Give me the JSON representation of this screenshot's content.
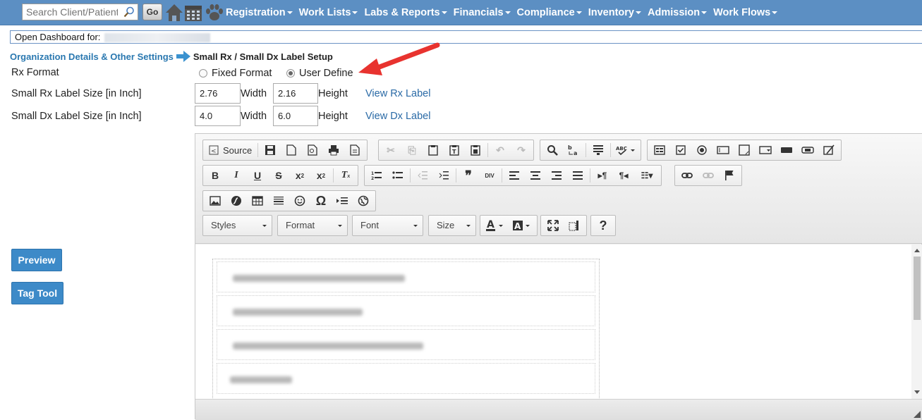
{
  "nav": {
    "search_placeholder": "Search Client/Patient",
    "go_label": "Go",
    "menu": [
      "Registration",
      "Work Lists",
      "Labs & Reports",
      "Financials",
      "Compliance",
      "Inventory",
      "Admission",
      "Work Flows"
    ],
    "icons": [
      "search-icon",
      "home-icon",
      "calendar-icon",
      "paw-icon"
    ],
    "bar_color": "#5c8fc3"
  },
  "dashboard": {
    "label": "Open Dashboard for:"
  },
  "breadcrumb": {
    "parent": "Organization Details & Other Settings",
    "current": "Small Rx / Small Dx Label Setup"
  },
  "form": {
    "rx_format_label": "Rx Format",
    "options": {
      "fixed": "Fixed Format",
      "user": "User Define",
      "selected": "User Define"
    },
    "rx_size_label": "Small Rx Label Size [in Inch]",
    "rx_width": "2.76",
    "rx_height": "2.16",
    "dx_size_label": "Small Dx Label Size [in Inch]",
    "dx_width": "4.0",
    "dx_height": "6.0",
    "width_label": "Width",
    "height_label": "Height",
    "view_rx": "View Rx Label",
    "view_dx": "View Dx Label"
  },
  "side_buttons": {
    "preview": "Preview",
    "tag_tool": "Tag Tool",
    "color": "#3d8ac8"
  },
  "editor": {
    "source_label": "Source",
    "combos": [
      "Styles",
      "Format",
      "Font",
      "Size"
    ],
    "help_label": "?"
  }
}
